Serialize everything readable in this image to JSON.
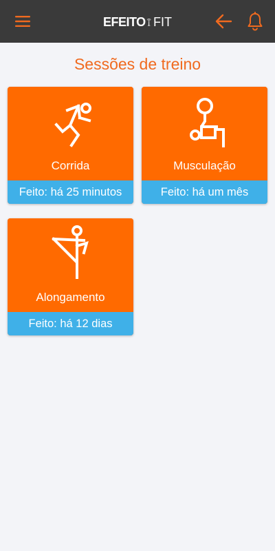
{
  "header": {
    "logo_left": "EFEITO",
    "logo_right": "FIT",
    "icons": [
      "menu-icon",
      "arrow-left-icon",
      "bell-icon"
    ],
    "colors": {
      "bar": "#3a3a3a",
      "accent": "#f06a1f"
    }
  },
  "page": {
    "title": "Sessões de treino"
  },
  "sessions": [
    {
      "label": "Corrida",
      "status": "Feito: há 25 minutos",
      "icon": "running-icon"
    },
    {
      "label": "Musculação",
      "status": "Feito: há um mês",
      "icon": "weightlifting-icon"
    },
    {
      "label": "Alongamento",
      "status": "Feito: há 12 dias",
      "icon": "stretching-icon"
    }
  ],
  "colors": {
    "card": "#ff6a00",
    "status_bar": "#3fb0e8",
    "background": "#f3f4f8"
  }
}
